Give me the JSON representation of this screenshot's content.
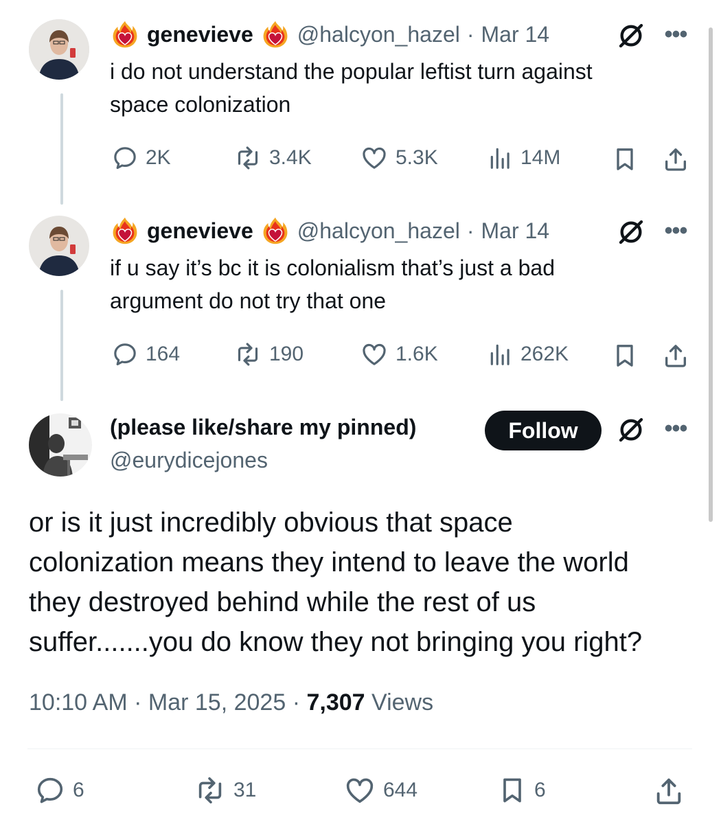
{
  "tweets": [
    {
      "name": "genevieve",
      "handle": "@halcyon_hazel",
      "date": "Mar 14",
      "separator": "·",
      "text_lines": [
        "i do not understand the popular leftist turn against",
        "space colonization"
      ],
      "replies": "2K",
      "retweets": "3.4K",
      "likes": "5.3K",
      "views": "14M"
    },
    {
      "name": "genevieve",
      "handle": "@halcyon_hazel",
      "date": "Mar 14",
      "separator": "·",
      "text_lines": [
        "if u say it’s bc it is colonialism that’s just a bad",
        "argument do not try that one"
      ],
      "replies": "164",
      "retweets": "190",
      "likes": "1.6K",
      "views": "262K"
    }
  ],
  "main": {
    "name": "(please like/share my pinned)",
    "handle": "@eurydicejones",
    "follow_label": "Follow",
    "text_lines": [
      "or is it just incredibly obvious that space",
      "colonization means they intend to leave the world",
      "they destroyed behind while the rest of us",
      "suffer.......you do know they not bringing you right?"
    ],
    "time": "10:10 AM",
    "date": "Mar 15, 2025",
    "separator": "·",
    "views_count": "7,307",
    "views_label": "Views",
    "replies": "6",
    "retweets": "31",
    "likes": "644",
    "bookmarks": "6"
  },
  "more_label": "•••",
  "icons": [
    "fire-heart-icon",
    "grok-icon",
    "more-icon",
    "reply-icon",
    "retweet-icon",
    "like-icon",
    "views-icon",
    "bookmark-icon",
    "share-icon"
  ],
  "colors": {
    "text": "#0f1419",
    "secondary": "#536471",
    "line": "#cfd9de",
    "button": "#0f1419"
  }
}
